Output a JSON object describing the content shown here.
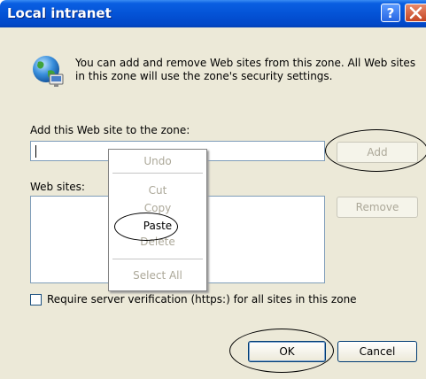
{
  "window": {
    "title": "Local intranet"
  },
  "info_text": "You can add and remove Web sites from this zone. All Web sites in this zone will use the zone's security settings.",
  "add_site": {
    "label": "Add this Web site to the zone:",
    "value": "",
    "button": "Add"
  },
  "websites": {
    "label": "Web sites:",
    "items": [],
    "remove_button": "Remove"
  },
  "context_menu": {
    "items": [
      "Undo",
      "Cut",
      "Copy",
      "Paste",
      "Delete",
      "Select All"
    ]
  },
  "require_https": {
    "label": "Require server verification (https:) for all sites in this zone",
    "checked": false
  },
  "footer": {
    "ok": "OK",
    "cancel": "Cancel"
  }
}
